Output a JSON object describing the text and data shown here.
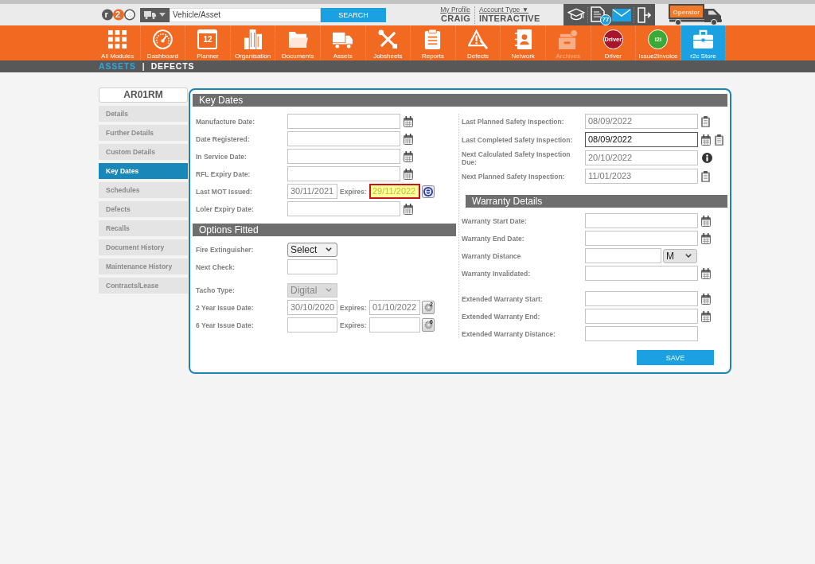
{
  "header": {
    "logo": "r2c",
    "search": {
      "value": "Vehicle/Asset",
      "button": "SEARCH"
    },
    "profile": {
      "link": "My Profile",
      "name": "CRAIG"
    },
    "account": {
      "link": "Account Type ▼",
      "value": "INTERACTIVE"
    },
    "notification_count": "77",
    "operator": "Operator"
  },
  "modules": [
    {
      "label": "All Modules",
      "selected": false,
      "disabled": false
    },
    {
      "label": "Dashboard",
      "selected": false,
      "disabled": false
    },
    {
      "label": "Planner",
      "icon_text": "12",
      "selected": false,
      "disabled": false
    },
    {
      "label": "Organisation",
      "selected": false,
      "disabled": false
    },
    {
      "label": "Documents",
      "selected": false,
      "disabled": false
    },
    {
      "label": "Assets",
      "selected": false,
      "disabled": false
    },
    {
      "label": "Jobsheets",
      "selected": false,
      "disabled": false
    },
    {
      "label": "Reports",
      "selected": false,
      "disabled": false
    },
    {
      "label": "Defects",
      "selected": false,
      "disabled": false
    },
    {
      "label": "Network",
      "selected": false,
      "disabled": false
    },
    {
      "label": "Archives",
      "selected": false,
      "disabled": true
    },
    {
      "label": "Driver",
      "icon_text": "Driver",
      "color": "#a8142a",
      "selected": false,
      "disabled": false
    },
    {
      "label": "Issue2Invoice",
      "icon_text": "i2i",
      "color": "#3aa935",
      "selected": false,
      "disabled": false
    },
    {
      "label": "r2c Store",
      "selected": true,
      "disabled": false
    }
  ],
  "subnav": {
    "items": [
      {
        "label": "ASSETS",
        "selected": true
      },
      {
        "label": "DEFECTS",
        "selected": false
      }
    ],
    "separator": "|"
  },
  "sidebar": {
    "title": "AR01RM",
    "items": [
      {
        "label": "Details",
        "selected": false
      },
      {
        "label": "Further Details",
        "selected": false
      },
      {
        "label": "Custom Details",
        "selected": false
      },
      {
        "label": "Key Dates",
        "selected": true
      },
      {
        "label": "Schedules",
        "selected": false
      },
      {
        "label": "Defects",
        "selected": false
      },
      {
        "label": "Recalls",
        "selected": false
      },
      {
        "label": "Document History",
        "selected": false
      },
      {
        "label": "Maintenance History",
        "selected": false
      },
      {
        "label": "Contracts/Lease",
        "selected": false
      }
    ]
  },
  "key_dates": {
    "title": "Key Dates",
    "rows": [
      {
        "kind": "date",
        "label": "Manufacture Date:"
      },
      {
        "kind": "date",
        "label": "Date Registered:"
      },
      {
        "kind": "date",
        "label": "In Service Date:"
      },
      {
        "kind": "date",
        "label": "RFL Expiry Date:"
      },
      {
        "kind": "mot",
        "label": "Last MOT Issued:",
        "value": "30/11/2021",
        "expires_label": "Expires:",
        "expires": "29/11/2022",
        "alert": true
      },
      {
        "kind": "date",
        "label": "Loler Expiry Date:"
      }
    ]
  },
  "options_fitted": {
    "title": "Options Fitted",
    "groups": [
      [
        {
          "kind": "select",
          "label": "Fire Extinguisher:",
          "value": "Select",
          "disabled": false
        },
        {
          "kind": "text",
          "label": "Next Check:"
        }
      ],
      [
        {
          "kind": "select",
          "label": "Tacho Type:",
          "value": "Digital",
          "disabled": true
        },
        {
          "kind": "renewal",
          "label": "2 Year Issue Date:",
          "value": "30/10/2020",
          "expires_label": "Expires:",
          "expires": "01/10/2022",
          "badge": "2"
        },
        {
          "kind": "renewal",
          "label": "6 Year Issue Date:",
          "expires_label": "Expires:",
          "badge": "6"
        }
      ]
    ]
  },
  "inspections": [
    {
      "kind": "record",
      "label": "Last Planned Safety Inspection:",
      "value": "08/09/2022",
      "focused": false
    },
    {
      "kind": "editable",
      "label": "Last Completed Safety Inspection:",
      "value": "08/09/2022",
      "focused": true
    },
    {
      "kind": "info",
      "label": "Next Calculated Safety Inspection Due:",
      "value": "20/10/2022",
      "focused": false
    },
    {
      "kind": "record",
      "label": "Next Planned Safety Inspection:",
      "value": "11/01/2023",
      "focused": false
    }
  ],
  "warranty": {
    "title": "Warranty Details",
    "groups": [
      [
        {
          "kind": "date",
          "label": "Warranty Start Date:"
        },
        {
          "kind": "date",
          "label": "Warranty End Date:"
        },
        {
          "kind": "distance",
          "label": "Warranty Distance",
          "unit": "M"
        },
        {
          "kind": "date",
          "label": "Warranty Invalidated:"
        }
      ],
      [
        {
          "kind": "date",
          "label": "Extended Warranty Start:"
        },
        {
          "kind": "date",
          "label": "Extended Warranty End:"
        },
        {
          "kind": "text",
          "label": "Extended Warranty Distance:"
        }
      ]
    ]
  },
  "save_button": "SAVE"
}
